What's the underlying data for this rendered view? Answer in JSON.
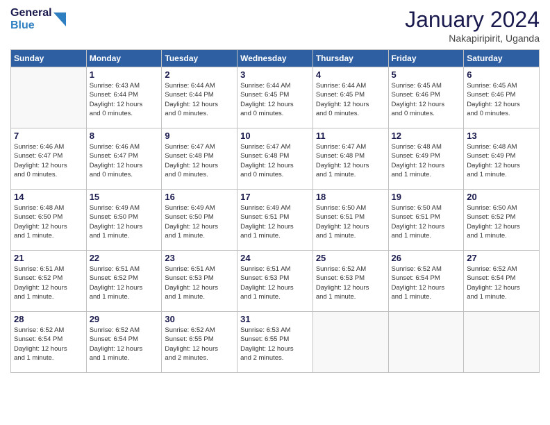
{
  "header": {
    "logo_line1": "General",
    "logo_line2": "Blue",
    "month_title": "January 2024",
    "location": "Nakapiripirit, Uganda"
  },
  "days_of_week": [
    "Sunday",
    "Monday",
    "Tuesday",
    "Wednesday",
    "Thursday",
    "Friday",
    "Saturday"
  ],
  "weeks": [
    [
      {
        "day": "",
        "info": ""
      },
      {
        "day": "1",
        "info": "Sunrise: 6:43 AM\nSunset: 6:44 PM\nDaylight: 12 hours\nand 0 minutes."
      },
      {
        "day": "2",
        "info": "Sunrise: 6:44 AM\nSunset: 6:44 PM\nDaylight: 12 hours\nand 0 minutes."
      },
      {
        "day": "3",
        "info": "Sunrise: 6:44 AM\nSunset: 6:45 PM\nDaylight: 12 hours\nand 0 minutes."
      },
      {
        "day": "4",
        "info": "Sunrise: 6:44 AM\nSunset: 6:45 PM\nDaylight: 12 hours\nand 0 minutes."
      },
      {
        "day": "5",
        "info": "Sunrise: 6:45 AM\nSunset: 6:46 PM\nDaylight: 12 hours\nand 0 minutes."
      },
      {
        "day": "6",
        "info": "Sunrise: 6:45 AM\nSunset: 6:46 PM\nDaylight: 12 hours\nand 0 minutes."
      }
    ],
    [
      {
        "day": "7",
        "info": "Sunrise: 6:46 AM\nSunset: 6:47 PM\nDaylight: 12 hours\nand 0 minutes."
      },
      {
        "day": "8",
        "info": "Sunrise: 6:46 AM\nSunset: 6:47 PM\nDaylight: 12 hours\nand 0 minutes."
      },
      {
        "day": "9",
        "info": "Sunrise: 6:47 AM\nSunset: 6:48 PM\nDaylight: 12 hours\nand 0 minutes."
      },
      {
        "day": "10",
        "info": "Sunrise: 6:47 AM\nSunset: 6:48 PM\nDaylight: 12 hours\nand 0 minutes."
      },
      {
        "day": "11",
        "info": "Sunrise: 6:47 AM\nSunset: 6:48 PM\nDaylight: 12 hours\nand 1 minute."
      },
      {
        "day": "12",
        "info": "Sunrise: 6:48 AM\nSunset: 6:49 PM\nDaylight: 12 hours\nand 1 minute."
      },
      {
        "day": "13",
        "info": "Sunrise: 6:48 AM\nSunset: 6:49 PM\nDaylight: 12 hours\nand 1 minute."
      }
    ],
    [
      {
        "day": "14",
        "info": "Sunrise: 6:48 AM\nSunset: 6:50 PM\nDaylight: 12 hours\nand 1 minute."
      },
      {
        "day": "15",
        "info": "Sunrise: 6:49 AM\nSunset: 6:50 PM\nDaylight: 12 hours\nand 1 minute."
      },
      {
        "day": "16",
        "info": "Sunrise: 6:49 AM\nSunset: 6:50 PM\nDaylight: 12 hours\nand 1 minute."
      },
      {
        "day": "17",
        "info": "Sunrise: 6:49 AM\nSunset: 6:51 PM\nDaylight: 12 hours\nand 1 minute."
      },
      {
        "day": "18",
        "info": "Sunrise: 6:50 AM\nSunset: 6:51 PM\nDaylight: 12 hours\nand 1 minute."
      },
      {
        "day": "19",
        "info": "Sunrise: 6:50 AM\nSunset: 6:51 PM\nDaylight: 12 hours\nand 1 minute."
      },
      {
        "day": "20",
        "info": "Sunrise: 6:50 AM\nSunset: 6:52 PM\nDaylight: 12 hours\nand 1 minute."
      }
    ],
    [
      {
        "day": "21",
        "info": "Sunrise: 6:51 AM\nSunset: 6:52 PM\nDaylight: 12 hours\nand 1 minute."
      },
      {
        "day": "22",
        "info": "Sunrise: 6:51 AM\nSunset: 6:52 PM\nDaylight: 12 hours\nand 1 minute."
      },
      {
        "day": "23",
        "info": "Sunrise: 6:51 AM\nSunset: 6:53 PM\nDaylight: 12 hours\nand 1 minute."
      },
      {
        "day": "24",
        "info": "Sunrise: 6:51 AM\nSunset: 6:53 PM\nDaylight: 12 hours\nand 1 minute."
      },
      {
        "day": "25",
        "info": "Sunrise: 6:52 AM\nSunset: 6:53 PM\nDaylight: 12 hours\nand 1 minute."
      },
      {
        "day": "26",
        "info": "Sunrise: 6:52 AM\nSunset: 6:54 PM\nDaylight: 12 hours\nand 1 minute."
      },
      {
        "day": "27",
        "info": "Sunrise: 6:52 AM\nSunset: 6:54 PM\nDaylight: 12 hours\nand 1 minute."
      }
    ],
    [
      {
        "day": "28",
        "info": "Sunrise: 6:52 AM\nSunset: 6:54 PM\nDaylight: 12 hours\nand 1 minute."
      },
      {
        "day": "29",
        "info": "Sunrise: 6:52 AM\nSunset: 6:54 PM\nDaylight: 12 hours\nand 1 minute."
      },
      {
        "day": "30",
        "info": "Sunrise: 6:52 AM\nSunset: 6:55 PM\nDaylight: 12 hours\nand 2 minutes."
      },
      {
        "day": "31",
        "info": "Sunrise: 6:53 AM\nSunset: 6:55 PM\nDaylight: 12 hours\nand 2 minutes."
      },
      {
        "day": "",
        "info": ""
      },
      {
        "day": "",
        "info": ""
      },
      {
        "day": "",
        "info": ""
      }
    ]
  ]
}
